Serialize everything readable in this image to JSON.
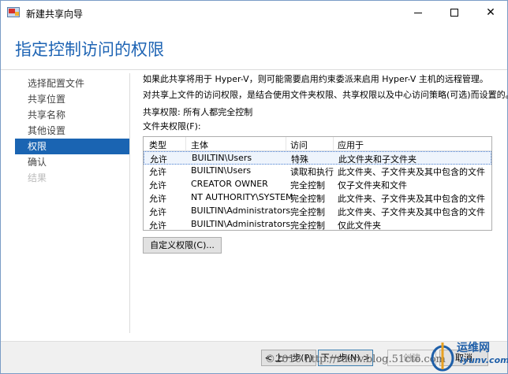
{
  "window": {
    "title": "新建共享向导",
    "colors": {
      "accent": "#1a64b2",
      "title": "#1e64b4"
    }
  },
  "header": {
    "title": "指定控制访问的权限"
  },
  "nav": {
    "items": [
      {
        "label": "选择配置文件",
        "state": "normal"
      },
      {
        "label": "共享位置",
        "state": "normal"
      },
      {
        "label": "共享名称",
        "state": "normal"
      },
      {
        "label": "其他设置",
        "state": "normal"
      },
      {
        "label": "权限",
        "state": "active"
      },
      {
        "label": "确认",
        "state": "normal"
      },
      {
        "label": "结果",
        "state": "disabled"
      }
    ]
  },
  "content": {
    "info1": "如果此共享将用于 Hyper-V，则可能需要启用约束委派来启用 Hyper-V 主机的远程管理。",
    "info2": "对共享上文件的访问权限，是结合使用文件夹权限、共享权限以及中心访问策略(可选)而设置的。",
    "share_permissions": "共享权限: 所有人都完全控制",
    "folder_permissions_label": "文件夹权限(F):"
  },
  "table": {
    "columns": [
      "类型",
      "主体",
      "访问",
      "应用于"
    ],
    "rows": [
      [
        "允许",
        "BUILTIN\\Users",
        "特殊",
        "此文件夹和子文件夹"
      ],
      [
        "允许",
        "BUILTIN\\Users",
        "读取和执行",
        "此文件夹、子文件夹及其中包含的文件"
      ],
      [
        "允许",
        "CREATOR OWNER",
        "完全控制",
        "仅子文件夹和文件"
      ],
      [
        "允许",
        "NT AUTHORITY\\SYSTEM",
        "完全控制",
        "此文件夹、子文件夹及其中包含的文件"
      ],
      [
        "允许",
        "BUILTIN\\Administrators",
        "完全控制",
        "此文件夹、子文件夹及其中包含的文件"
      ],
      [
        "允许",
        "BUILTIN\\Administrators",
        "完全控制",
        "仅此文件夹"
      ]
    ],
    "selected_row": 0
  },
  "buttons": {
    "customize": "自定义权限(C)...",
    "back": "< 上一步(P)",
    "next": "下一步(N) >",
    "create": "创建",
    "cancel": "取消"
  },
  "watermark": {
    "text": "©2016 http://rdsrv.blog.51cto.com",
    "logo_line1": "运维网",
    "logo_line2": "iyunv.com"
  },
  "icons": {
    "app": "share-wizard-icon",
    "minimize": "minimize-icon",
    "maximize": "maximize-icon",
    "close": "close-icon"
  }
}
